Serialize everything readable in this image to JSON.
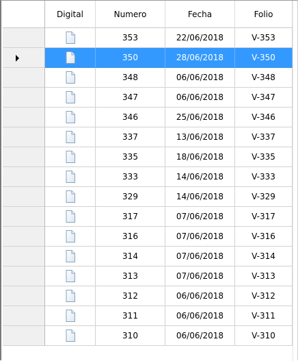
{
  "columns": {
    "digital": "Digital",
    "numero": "Numero",
    "fecha": "Fecha",
    "folio": "Folio"
  },
  "selected_index": 1,
  "rows": [
    {
      "numero": "353",
      "fecha": "22/06/2018",
      "folio": "V-353"
    },
    {
      "numero": "350",
      "fecha": "28/06/2018",
      "folio": "V-350"
    },
    {
      "numero": "348",
      "fecha": "06/06/2018",
      "folio": "V-348"
    },
    {
      "numero": "347",
      "fecha": "06/06/2018",
      "folio": "V-347"
    },
    {
      "numero": "346",
      "fecha": "25/06/2018",
      "folio": "V-346"
    },
    {
      "numero": "337",
      "fecha": "13/06/2018",
      "folio": "V-337"
    },
    {
      "numero": "335",
      "fecha": "18/06/2018",
      "folio": "V-335"
    },
    {
      "numero": "333",
      "fecha": "14/06/2018",
      "folio": "V-333"
    },
    {
      "numero": "329",
      "fecha": "14/06/2018",
      "folio": "V-329"
    },
    {
      "numero": "317",
      "fecha": "07/06/2018",
      "folio": "V-317"
    },
    {
      "numero": "316",
      "fecha": "07/06/2018",
      "folio": "V-316"
    },
    {
      "numero": "314",
      "fecha": "07/06/2018",
      "folio": "V-314"
    },
    {
      "numero": "313",
      "fecha": "07/06/2018",
      "folio": "V-313"
    },
    {
      "numero": "312",
      "fecha": "06/06/2018",
      "folio": "V-312"
    },
    {
      "numero": "311",
      "fecha": "06/06/2018",
      "folio": "V-311"
    },
    {
      "numero": "310",
      "fecha": "06/06/2018",
      "folio": "V-310"
    }
  ],
  "colors": {
    "selection": "#3399ff",
    "row_header": "#f0f0f0",
    "grid_line": "#d2d2d2"
  },
  "icons": {
    "digital_cell": "document-icon",
    "row_indicator": "current-row-arrow-icon"
  }
}
